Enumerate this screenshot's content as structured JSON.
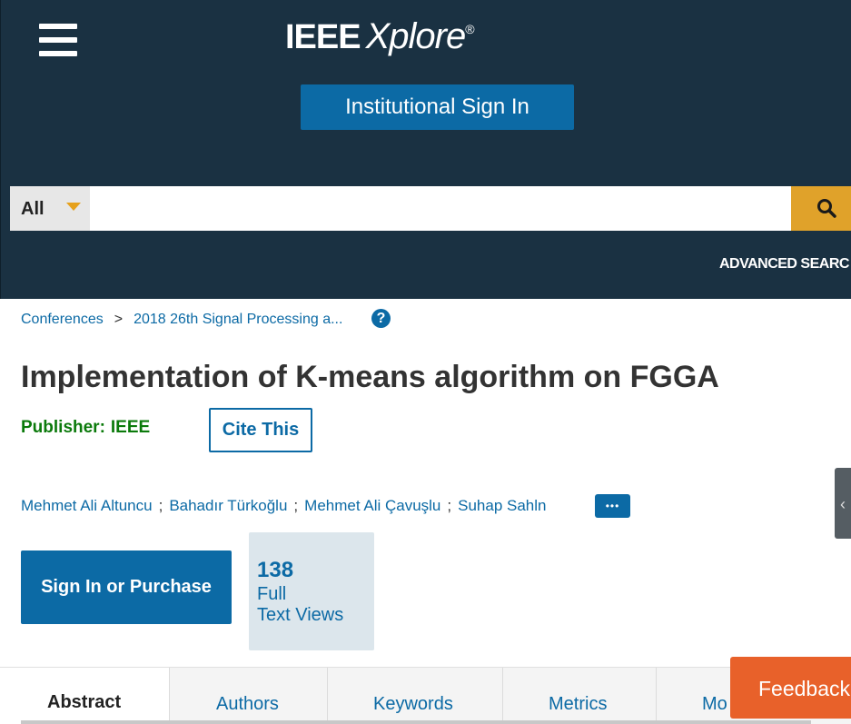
{
  "header": {
    "menu_icon": "hamburger-menu-icon",
    "logo_ieee": "IEEE",
    "logo_xplore": "Xplore",
    "logo_reg": "®",
    "institutional_signin": "Institutional Sign In",
    "background_color": "#1a3142"
  },
  "search": {
    "scope": "All",
    "placeholder": "",
    "value": "",
    "search_icon": "magnifier-icon",
    "advanced": "ADVANCED SEARC"
  },
  "breadcrumb": {
    "items": [
      "Conferences",
      "2018 26th Signal Processing a..."
    ],
    "separator": ">",
    "help_glyph": "?"
  },
  "article": {
    "title": "Implementation of K-means algorithm on FGGA",
    "publisher_label": "Publisher:",
    "publisher_value": "IEEE",
    "cite_button": "Cite This",
    "authors": [
      "Mehmet Ali Altuncu",
      "Bahadır Türkoğlu",
      "Mehmet Ali Çavuşlu",
      "Suhap Sahln"
    ],
    "author_separator": ";",
    "more_authors_glyph": "•••"
  },
  "access": {
    "signin_button": "Sign In or Purchase",
    "views_count": "138",
    "views_label_line1": "Full",
    "views_label_line2": "Text Views"
  },
  "tabs": {
    "items": [
      "Abstract",
      "Authors",
      "Keywords",
      "Metrics",
      "Mo"
    ],
    "active": "Abstract"
  },
  "feedback": "Feedback",
  "colors": {
    "primary_blue": "#0c6aa5",
    "accent_gold": "#e0a22a",
    "publisher_green": "#0b7a0b",
    "feedback_orange": "#e8612a"
  }
}
